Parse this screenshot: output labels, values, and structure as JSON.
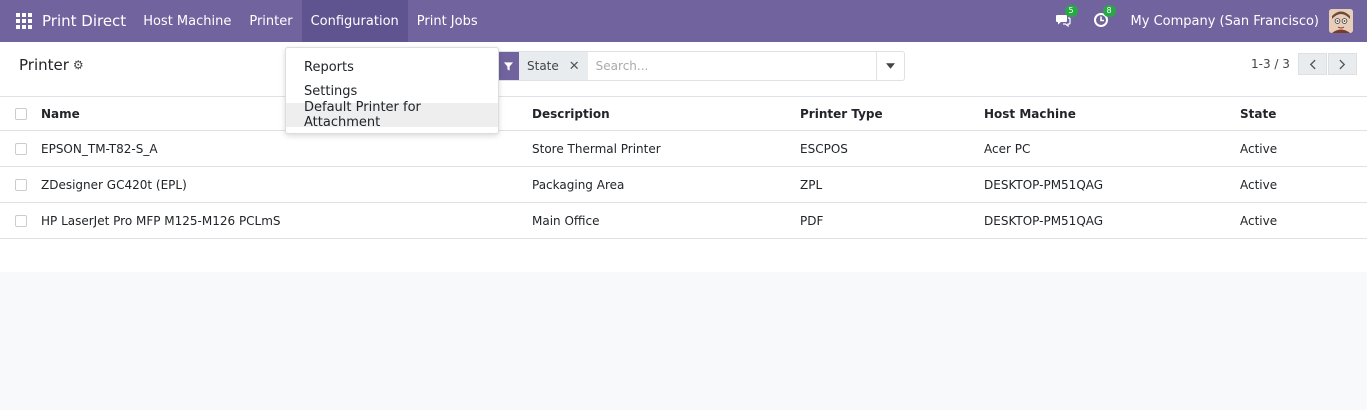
{
  "navbar": {
    "brand": "Print Direct",
    "menu": [
      "Host Machine",
      "Printer",
      "Configuration",
      "Print Jobs"
    ],
    "messages_badge": "5",
    "activities_badge": "8",
    "company": "My Company (San Francisco)"
  },
  "control_panel": {
    "title": "Printer",
    "facet_label": "State",
    "search_placeholder": "Search...",
    "pager": "1-3 / 3"
  },
  "dropdown": {
    "items": [
      "Reports",
      "Settings",
      "Default Printer for Attachment"
    ]
  },
  "table": {
    "headers": [
      "Name",
      "Description",
      "Printer Type",
      "Host Machine",
      "State"
    ],
    "rows": [
      [
        "EPSON_TM-T82-S_A",
        "Store Thermal Printer",
        "ESCPOS",
        "Acer PC",
        "Active"
      ],
      [
        "ZDesigner GC420t (EPL)",
        "Packaging Area",
        "ZPL",
        "DESKTOP-PM51QAG",
        "Active"
      ],
      [
        "HP LaserJet Pro MFP M125-M126 PCLmS",
        "Main Office",
        "PDF",
        "DESKTOP-PM51QAG",
        "Active"
      ]
    ]
  },
  "colors": {
    "navbar": "#71639e",
    "navbar_active": "#5f5390",
    "badge": "#28a745"
  }
}
